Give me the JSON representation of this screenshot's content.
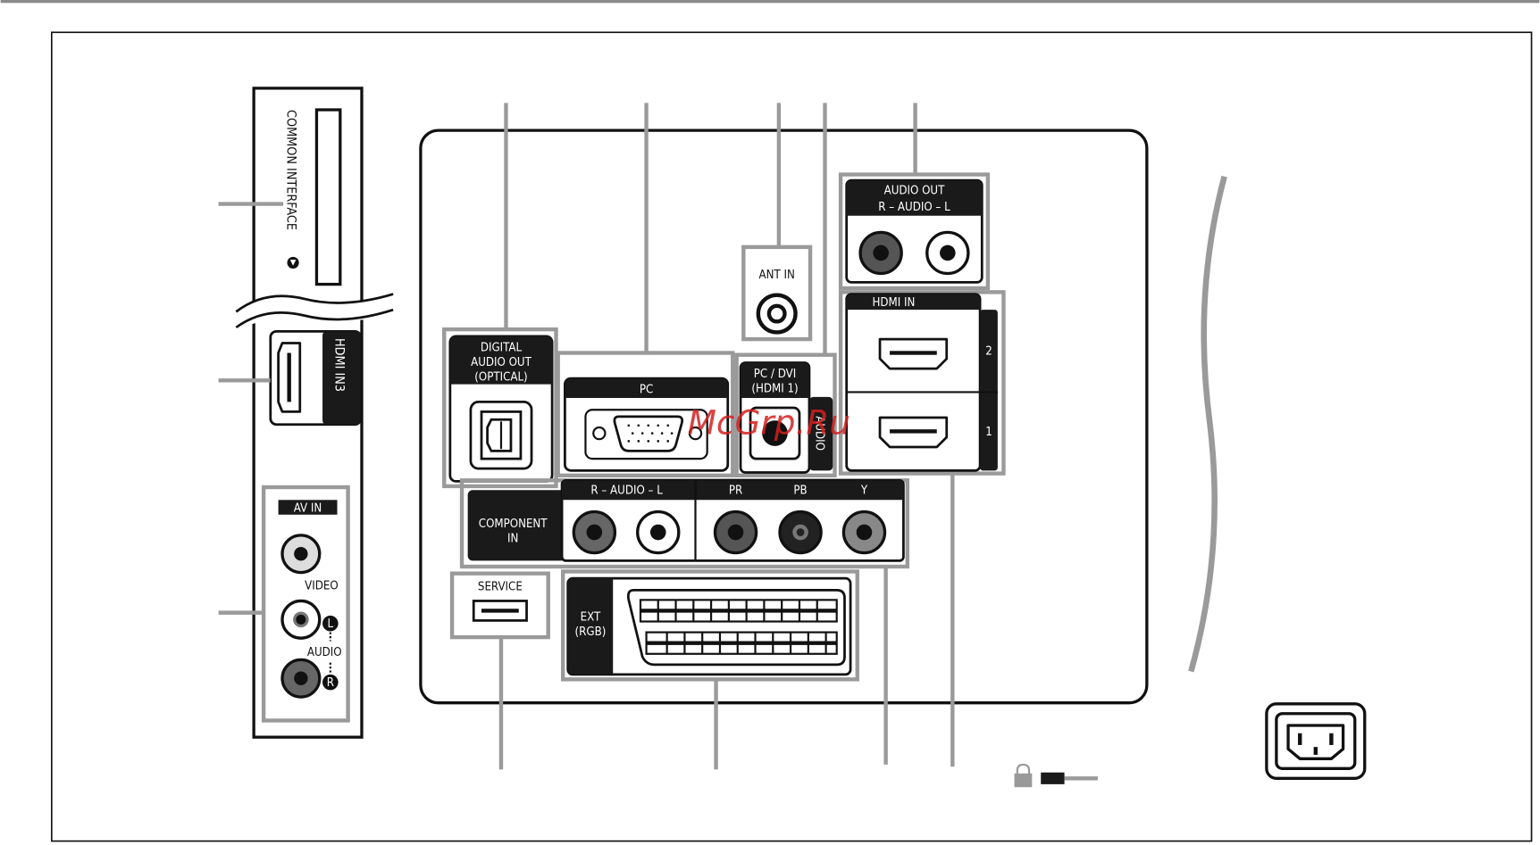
{
  "side_panel": {
    "common_interface": "COMMON INTERFACE",
    "hdmi_in3": "HDMI IN3",
    "av_in": "AV IN",
    "video": "VIDEO",
    "audio": "AUDIO",
    "left": "L",
    "right": "R"
  },
  "main_panel": {
    "digital_audio_out": [
      "DIGITAL",
      "AUDIO OUT",
      "(OPTICAL)"
    ],
    "pc": "PC",
    "ant_in": "ANT IN",
    "pc_dvi": [
      "PC / DVI",
      "(HDMI 1)"
    ],
    "pc_dvi_audio": "AUDIO",
    "audio_out": "AUDIO OUT",
    "audio_out_channels": "R – AUDIO – L",
    "hdmi_in": "HDMI IN",
    "hdmi_port_2": "2",
    "hdmi_port_1": "1",
    "component_in": [
      "COMPONENT",
      "IN"
    ],
    "component_audio": "R – AUDIO – L",
    "component_pr": "PR",
    "component_pb": "PB",
    "component_y": "Y",
    "service": "SERVICE",
    "ext_rgb": [
      "EXT",
      "(RGB)"
    ]
  },
  "watermark": "McGrp.Ru",
  "colors": {
    "callout": "#9a9a9a",
    "watermark": "#d42020",
    "label_bg": "#1a1a1a"
  }
}
